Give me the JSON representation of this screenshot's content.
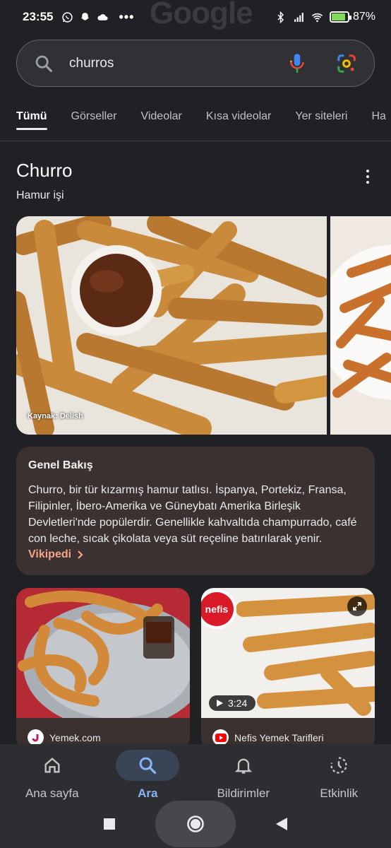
{
  "status_bar": {
    "time": "23:55",
    "battery_percent": "87%",
    "battery_level": 0.87,
    "battery_color": "#7ed957"
  },
  "background_logo": "Google",
  "search": {
    "query": "churros",
    "icons": [
      "search-icon",
      "mic-icon",
      "lens-icon"
    ]
  },
  "tabs": [
    {
      "label": "Tümü",
      "active": true
    },
    {
      "label": "Görseller"
    },
    {
      "label": "Videolar"
    },
    {
      "label": "Kısa videolar"
    },
    {
      "label": "Yer siteleri"
    },
    {
      "label": "Ha"
    }
  ],
  "knowledge_panel": {
    "title": "Churro",
    "subtitle": "Hamur işi",
    "image_caption": "Kaynak: Delish"
  },
  "overview": {
    "title": "Genel Bakış",
    "text": "Churro, bir tür kızarmış hamur tatlısı. İspanya, Portekiz, Fransa, Filipinler, İbero-Amerika ve Güneybatı Amerika Birleşik Devletleri'nde popülerdir. Genellikle kahvaltıda champurrado, café con leche, sıcak çikolata veya süt reçeline batırılarak yenir.",
    "link": "Vikipedi",
    "accent_color": "#f7a58a"
  },
  "results": [
    {
      "source": "Yemek.com",
      "source_icon_color": "#c2185b"
    },
    {
      "source": "Nefis Yemek Tarifleri",
      "duration": "3:24",
      "source_icon_color": "#ff0000"
    }
  ],
  "bottom_nav": [
    {
      "label": "Ana sayfa",
      "icon": "home-icon"
    },
    {
      "label": "Ara",
      "icon": "search-icon",
      "active": true
    },
    {
      "label": "Bildirimler",
      "icon": "bell-icon"
    },
    {
      "label": "Etkinlik",
      "icon": "activity-icon"
    }
  ],
  "colors": {
    "background": "#202124",
    "active_nav": "#8ab4f8"
  }
}
